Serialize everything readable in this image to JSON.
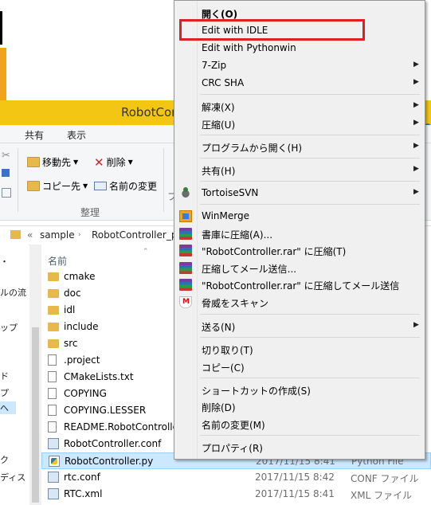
{
  "window": {
    "title": "RobotController",
    "tabs": [
      "共有",
      "表示"
    ],
    "ribbon": {
      "move_to": "移動先",
      "copy_to": "コピー先",
      "delete": "削除",
      "rename": "名前の変更",
      "group_label": "整理",
      "group_label_partial": "フ"
    },
    "address": {
      "prefix": "«",
      "crumbs": [
        "sample",
        "RobotController_p"
      ]
    },
    "nav_items": [
      "ルの流",
      "ップ",
      "ド",
      "プ",
      "へ",
      "ク",
      "ディス"
    ],
    "column_name": "名前",
    "files": [
      {
        "name": "cmake",
        "icon": "folder-icon",
        "date": "",
        "type": ""
      },
      {
        "name": "doc",
        "icon": "folder-icon",
        "date": "",
        "type": ""
      },
      {
        "name": "idl",
        "icon": "folder-icon",
        "date": "",
        "type": ""
      },
      {
        "name": "include",
        "icon": "folder-icon",
        "date": "",
        "type": ""
      },
      {
        "name": "src",
        "icon": "folder-icon",
        "date": "",
        "type": ""
      },
      {
        "name": ".project",
        "icon": "file-icon",
        "date": "",
        "type": ""
      },
      {
        "name": "CMakeLists.txt",
        "icon": "text-file-icon",
        "date": "",
        "type": ""
      },
      {
        "name": "COPYING",
        "icon": "file-icon",
        "date": "",
        "type": ""
      },
      {
        "name": "COPYING.LESSER",
        "icon": "file-icon",
        "date": "",
        "type": ""
      },
      {
        "name": "README.RobotControlle",
        "icon": "file-icon",
        "date": "",
        "type": ""
      },
      {
        "name": "RobotController.conf",
        "icon": "conf-file-icon",
        "date": "",
        "type": ""
      },
      {
        "name": "RobotController.py",
        "icon": "python-file-icon",
        "date": "2017/11/15 8:41",
        "type": "Python File"
      },
      {
        "name": "rtc.conf",
        "icon": "conf-file-icon",
        "date": "2017/11/15 8:42",
        "type": "CONF ファイル"
      },
      {
        "name": "RTC.xml",
        "icon": "xml-file-icon",
        "date": "2017/11/15 8:41",
        "type": "XML ファイル"
      }
    ]
  },
  "context_menu": {
    "items": [
      {
        "label": "開く(O)",
        "bold": true,
        "submenu": false,
        "icon": ""
      },
      {
        "label": "Edit with IDLE",
        "submenu": false,
        "icon": ""
      },
      {
        "label": "Edit with Pythonwin",
        "submenu": false,
        "icon": ""
      },
      {
        "label": "7-Zip",
        "submenu": true,
        "icon": ""
      },
      {
        "label": "CRC SHA",
        "submenu": true,
        "icon": ""
      },
      {
        "label": "解凍(X)",
        "submenu": true,
        "icon": ""
      },
      {
        "label": "圧縮(U)",
        "submenu": true,
        "icon": ""
      },
      {
        "label": "プログラムから開く(H)",
        "submenu": true,
        "icon": ""
      },
      {
        "label": "共有(H)",
        "submenu": true,
        "icon": ""
      },
      {
        "label": "TortoiseSVN",
        "submenu": true,
        "icon": "tortoisesvn-icon"
      },
      {
        "label": "WinMerge",
        "submenu": false,
        "icon": "winmerge-icon"
      },
      {
        "label": "書庫に圧縮(A)...",
        "submenu": false,
        "icon": "winrar-icon"
      },
      {
        "label": "\"RobotController.rar\" に圧縮(T)",
        "submenu": false,
        "icon": "winrar-icon"
      },
      {
        "label": "圧縮してメール送信...",
        "submenu": false,
        "icon": "winrar-icon"
      },
      {
        "label": "\"RobotController.rar\" に圧縮してメール送信",
        "submenu": false,
        "icon": "winrar-icon"
      },
      {
        "label": "脅威をスキャン",
        "submenu": false,
        "icon": "mcafee-icon"
      },
      {
        "label": "送る(N)",
        "submenu": true,
        "icon": ""
      },
      {
        "label": "切り取り(T)",
        "submenu": false,
        "icon": ""
      },
      {
        "label": "コピー(C)",
        "submenu": false,
        "icon": ""
      },
      {
        "label": "ショートカットの作成(S)",
        "submenu": false,
        "icon": ""
      },
      {
        "label": "削除(D)",
        "submenu": false,
        "icon": ""
      },
      {
        "label": "名前の変更(M)",
        "submenu": false,
        "icon": ""
      },
      {
        "label": "プロパティ(R)",
        "submenu": false,
        "icon": ""
      }
    ],
    "highlighted": "Edit with IDLE",
    "highlight_color": "#e02020"
  }
}
